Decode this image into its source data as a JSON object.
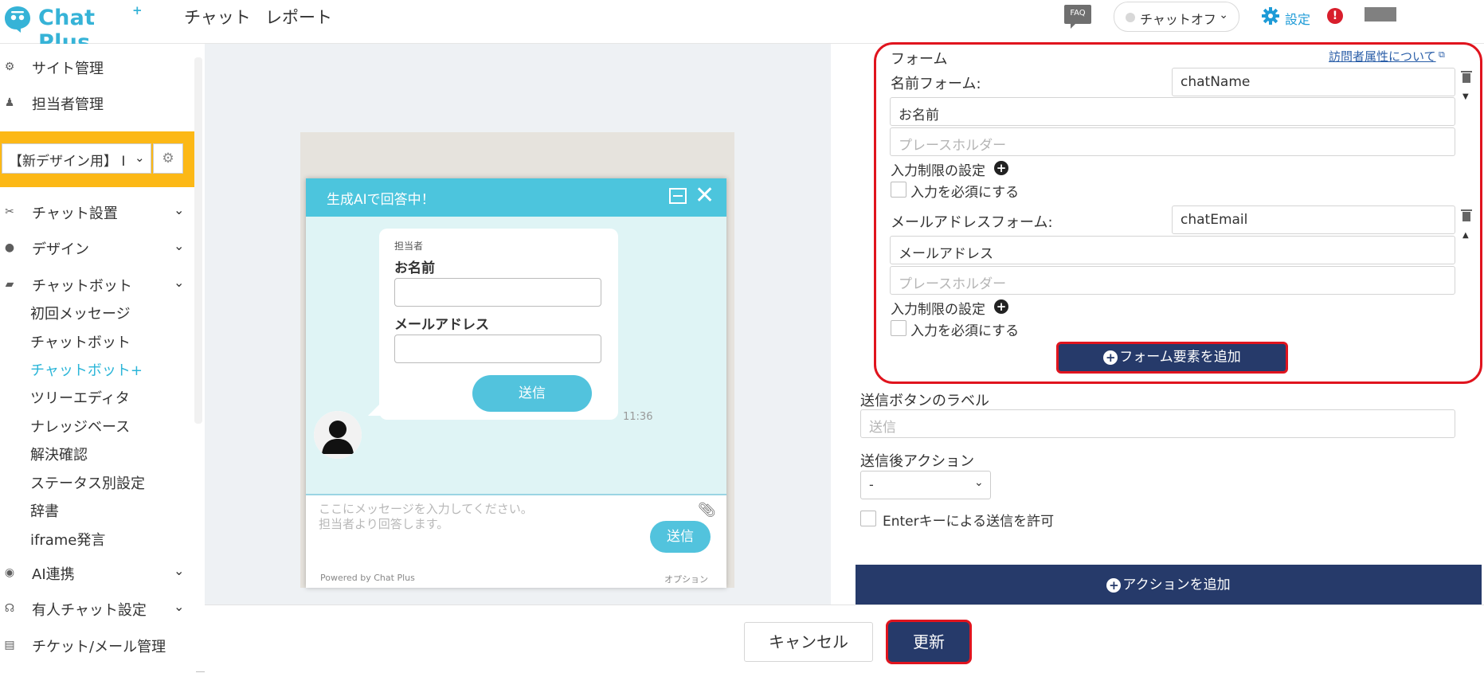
{
  "app": {
    "logo_text": "Chat Plus",
    "logo_sup": "+"
  },
  "header": {
    "nav": [
      "チャット",
      "レポート"
    ],
    "faq_label": "FAQ",
    "status": "チャットオフ",
    "settings_label": "設定",
    "alert_symbol": "!"
  },
  "sidebar": {
    "top_items": [
      "サイト管理",
      "担当者管理"
    ],
    "site_select": "【新デザイン用】 I",
    "sections": [
      {
        "label": "チャット設置",
        "icon": "tools-icon"
      },
      {
        "label": "デザイン",
        "icon": "palette-icon"
      },
      {
        "label": "チャットボット",
        "icon": "chat-bubbles-icon"
      }
    ],
    "chatbot_sub": [
      "初回メッセージ",
      "チャットボット",
      "チャットボット+",
      "ツリーエディタ",
      "ナレッジベース",
      "解決確認",
      "ステータス別設定",
      "辞書",
      "iframe発言"
    ],
    "bottom_sections": [
      {
        "label": "AI連携",
        "icon": "ai-icon"
      },
      {
        "label": "有人チャット設定",
        "icon": "headset-icon"
      },
      {
        "label": "チケット/メール管理",
        "icon": "ticket-icon"
      }
    ]
  },
  "preview": {
    "title": "生成AIで回答中！",
    "agent_label": "担当者",
    "field1_label": "お名前",
    "field2_label": "メールアドレス",
    "send_label": "送信",
    "time": "11:36",
    "input_placeholder": "ここにメッセージを入力してください。\n担当者より回答します。",
    "footer_send": "送信",
    "powered_by": "Powered by Chat Plus",
    "option_label": "オプション"
  },
  "editor": {
    "form_title": "フォーム",
    "help_link": "訪問者属性について",
    "name_form_label": "名前フォーム:",
    "name_key": "chatName",
    "name_label_value": "お名前",
    "placeholder_hint": "プレースホルダー",
    "restriction_label": "入力制限の設定",
    "required_label": "入力を必須にする",
    "email_form_label": "メールアドレスフォーム:",
    "email_key": "chatEmail",
    "email_label_value": "メールアドレス",
    "add_form_element": "フォーム要素を追加",
    "send_button_label_title": "送信ボタンのラベル",
    "send_button_placeholder": "送信",
    "after_action_title": "送信後アクション",
    "after_action_value": "-",
    "enter_send_label": "Enterキーによる送信を許可",
    "add_action": "アクションを追加"
  },
  "footer": {
    "cancel": "キャンセル",
    "update": "更新"
  },
  "colors": {
    "brand": "#36b3d7",
    "navy": "#263a6a",
    "highlight": "#e0141e",
    "sidebar_highlight": "#fcb816",
    "active_link": "#2bb5d8"
  }
}
